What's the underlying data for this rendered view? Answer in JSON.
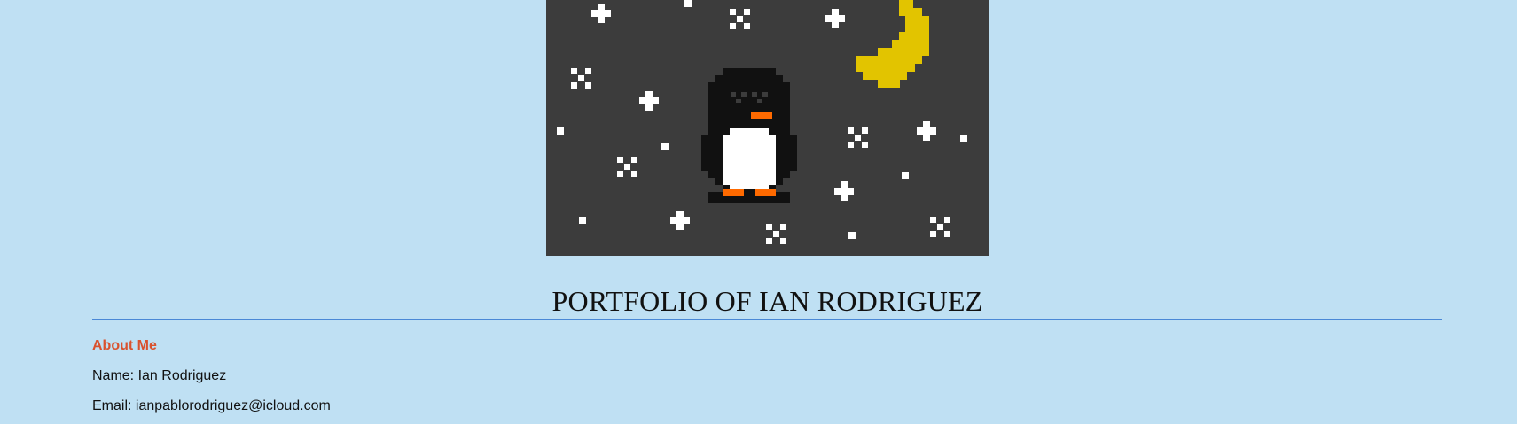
{
  "banner": {
    "alt": "pixel art penguin under a crescent moon on a starry night sky",
    "colors": {
      "sky": "#3c3c3c",
      "star": "#ffffff",
      "moon": "#e2c400",
      "penguin_body": "#111111",
      "penguin_belly": "#ffffff",
      "penguin_beak_feet": "#ff6a00"
    }
  },
  "header": {
    "title": "PORTFOLIO OF IAN RODRIGUEZ"
  },
  "about": {
    "heading": "About Me",
    "name_line": "Name: Ian Rodriguez",
    "email_line": "Email: ianpablorodriguez@icloud.com"
  }
}
